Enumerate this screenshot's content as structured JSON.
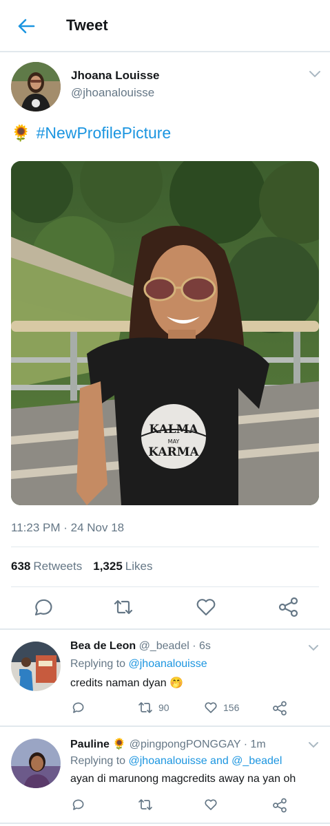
{
  "header": {
    "title": "Tweet",
    "back_icon": "back-arrow-icon"
  },
  "tweet": {
    "author_name": "Jhoana Louisse",
    "author_handle": "@jhoanalouisse",
    "emoji": "🌻",
    "hashtag": "#NewProfilePicture",
    "timestamp": "11:23 PM · 24 Nov 18",
    "retweets_count": "638",
    "retweets_label": "Retweets",
    "likes_count": "1,325",
    "likes_label": "Likes",
    "photo_shirt_text_top": "KALMA",
    "photo_shirt_text_mid": "MAY",
    "photo_shirt_text_bottom": "KARMA"
  },
  "replies": [
    {
      "name": "Bea de Leon",
      "handle": "@_beadel",
      "time": "· 6s",
      "replying_prefix": "Replying to",
      "replying_to": "@jhoanalouisse",
      "text": "credits naman dyan 🤭",
      "retweets": "90",
      "likes": "156"
    },
    {
      "name": "Pauline 🌻",
      "handle": "@pingpongPONGGAY",
      "time": "· 1m",
      "replying_prefix": "Replying to",
      "replying_to": "@jhoanalouisse and @_beadel",
      "text": "ayan di marunong magcredits away na yan oh"
    }
  ],
  "colors": {
    "accent": "#1b95e0",
    "muted": "#657786",
    "text": "#14171a",
    "divider": "#e1e8ed"
  }
}
